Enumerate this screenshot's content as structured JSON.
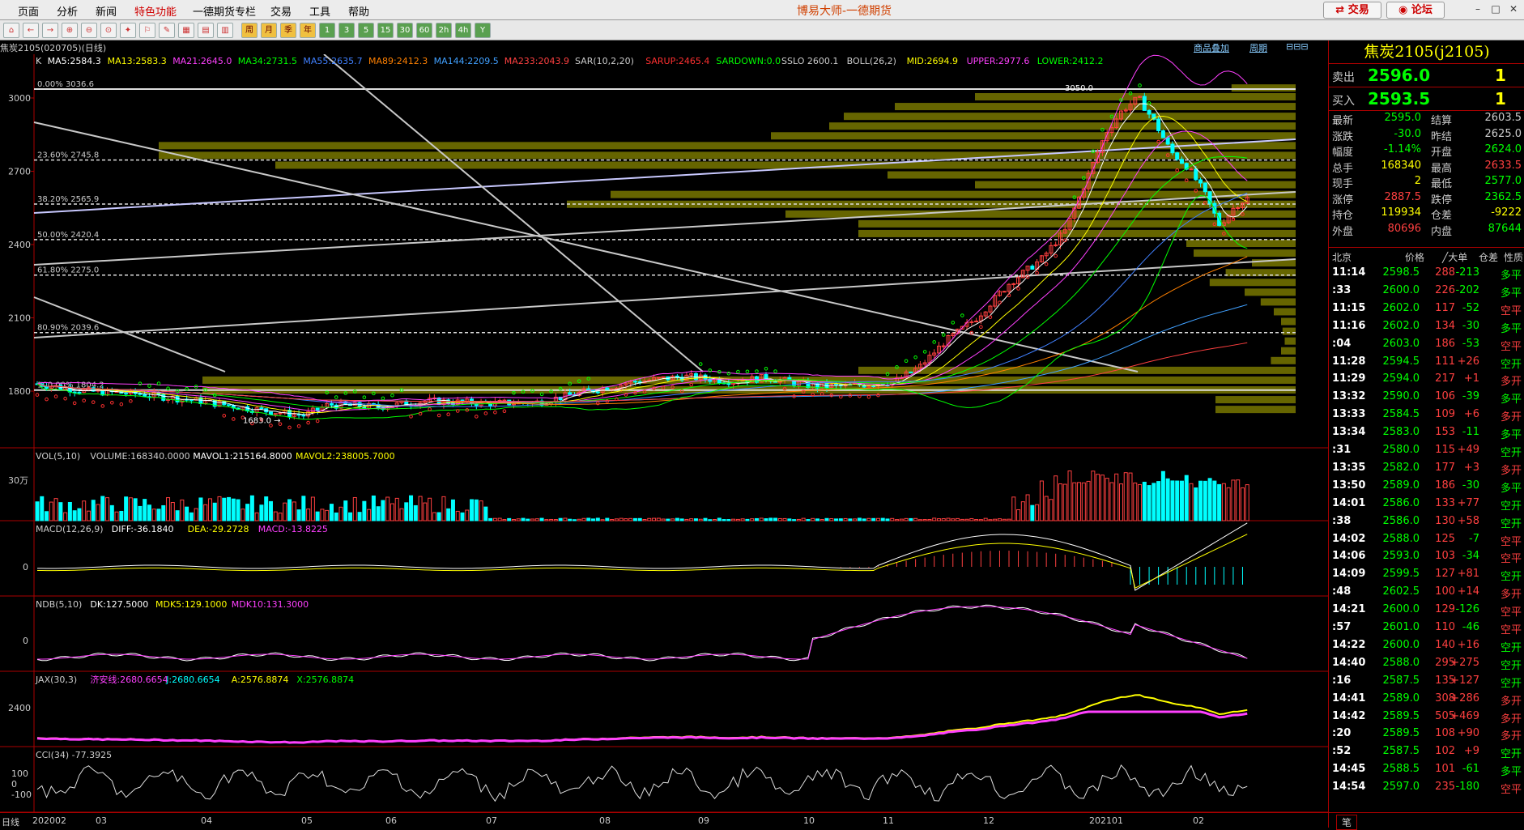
{
  "menu": [
    "页面",
    "分析",
    "新闻",
    "特色功能",
    "一德期货专栏",
    "交易",
    "工具",
    "帮助"
  ],
  "app_title": "博易大师-一德期货",
  "trade_button": "交易",
  "forum_button": "论坛",
  "toolbar_period_buttons": [
    "周",
    "月",
    "季",
    "年",
    "1",
    "3",
    "5",
    "15",
    "30",
    "60",
    "2h",
    "4h",
    "Y"
  ],
  "contract_label": "焦炭2105(020705)(日线)",
  "links": {
    "overlay": "商品叠加",
    "period": "周期"
  },
  "main_indicator": "K  MA5:2584.3  MA13:2583.3  MA21:2645.0  MA34:2731.5  MA55:2635.7  MA89:2412.3  MA144:2209.5  MA233:2043.9  SAR(10,2,20)  SARUP:2465.4  SARDOWN:0.0  SSLO 2600.1  BOLL(26,2)  MID:2694.9  UPPER:2977.6  LOWER:2412.2",
  "main_indicator_parts": [
    {
      "t": "K",
      "c": "#dddddd"
    },
    {
      "t": "MA5:2584.3",
      "c": "#ffffff"
    },
    {
      "t": "MA13:2583.3",
      "c": "#ffff00"
    },
    {
      "t": "MA21:2645.0",
      "c": "#ff40ff"
    },
    {
      "t": "MA34:2731.5",
      "c": "#00ff00"
    },
    {
      "t": "MA55:2635.7",
      "c": "#4080ff"
    },
    {
      "t": "MA89:2412.3",
      "c": "#ff8000"
    },
    {
      "t": "MA144:2209.5",
      "c": "#40a0ff"
    },
    {
      "t": "MA233:2043.9",
      "c": "#ff4040"
    },
    {
      "t": "SAR(10,2,20)",
      "c": "#cccccc"
    },
    {
      "t": "SARUP:2465.4",
      "c": "#ff3030"
    },
    {
      "t": "SARDOWN:0.0",
      "c": "#00ff00"
    },
    {
      "t": "SSLO 2600.1",
      "c": "#cccccc"
    },
    {
      "t": "BOLL(26,2)",
      "c": "#cccccc"
    },
    {
      "t": "MID:2694.9",
      "c": "#ffff00"
    },
    {
      "t": "UPPER:2977.6",
      "c": "#ff40ff"
    },
    {
      "t": "LOWER:2412.2",
      "c": "#00ff00"
    }
  ],
  "y_axis_main": [
    "3000",
    "2700",
    "2400",
    "2100",
    "1800"
  ],
  "fib_labels": [
    "0.00% 3036.6",
    "23.60% 2745.8",
    "38.20% 2565.9",
    "50.00% 2420.4",
    "61.80% 2275.0",
    "80.90% 2039.6",
    "100.00% 1804.2"
  ],
  "price_annotations": {
    "high": "3050.0",
    "low": "1683.0"
  },
  "vol_indicator_parts": [
    {
      "t": "VOL(5,10)",
      "c": "#cccccc"
    },
    {
      "t": "VOLUME:168340.0000",
      "c": "#cccccc"
    },
    {
      "t": "MAVOL1:215164.8000",
      "c": "#ffffff"
    },
    {
      "t": "MAVOL2:238005.7000",
      "c": "#ffff00"
    }
  ],
  "vol_axis": "30万",
  "macd_parts": [
    {
      "t": "MACD(12,26,9)",
      "c": "#cccccc"
    },
    {
      "t": "DIFF:-36.1840",
      "c": "#ffffff"
    },
    {
      "t": "DEA:-29.2728",
      "c": "#ffff00"
    },
    {
      "t": "MACD:-13.8225",
      "c": "#ff40ff"
    }
  ],
  "macd_axis": "0",
  "ndb_parts": [
    {
      "t": "NDB(5,10)",
      "c": "#cccccc"
    },
    {
      "t": "DK:127.5000",
      "c": "#ffffff"
    },
    {
      "t": "MDK5:129.1000",
      "c": "#ffff00"
    },
    {
      "t": "MDK10:131.3000",
      "c": "#ff40ff"
    }
  ],
  "ndb_axis": "0",
  "jax_parts": [
    {
      "t": "JAX(30,3)",
      "c": "#cccccc"
    },
    {
      "t": "济安线:2680.6654",
      "c": "#ff40ff"
    },
    {
      "t": "J:2680.6654",
      "c": "#00ffff"
    },
    {
      "t": "A:2576.8874",
      "c": "#ffff00"
    },
    {
      "t": "X:2576.8874",
      "c": "#00ff00"
    }
  ],
  "jax_axis": "2400",
  "cci_label": "CCI(34) -77.3925",
  "cci_axis": [
    "100",
    "0",
    "-100"
  ],
  "x_axis": [
    "日线",
    "202002",
    "03",
    "04",
    "05",
    "06",
    "07",
    "08",
    "09",
    "10",
    "11",
    "12",
    "202101",
    "02"
  ],
  "right_panel": {
    "title": "焦炭2105(j2105)",
    "sell": {
      "label": "卖出",
      "price": "2596.0",
      "vol": "1"
    },
    "buy": {
      "label": "买入",
      "price": "2593.5",
      "vol": "1"
    },
    "stats": [
      {
        "l": "最新",
        "v": "2595.0",
        "c": "#00ff00",
        "l2": "结算",
        "v2": "2603.5",
        "c2": "#cccccc"
      },
      {
        "l": "涨跌",
        "v": "-30.0",
        "c": "#00ff00",
        "l2": "昨结",
        "v2": "2625.0",
        "c2": "#cccccc"
      },
      {
        "l": "幅度",
        "v": "-1.14%",
        "c": "#00ff00",
        "l2": "开盘",
        "v2": "2624.0",
        "c2": "#00ff00"
      },
      {
        "l": "总手",
        "v": "168340",
        "c": "#ffff00",
        "l2": "最高",
        "v2": "2633.5",
        "c2": "#ff4040"
      },
      {
        "l": "现手",
        "v": "2",
        "c": "#ffff00",
        "l2": "最低",
        "v2": "2577.0",
        "c2": "#00ff00"
      },
      {
        "l": "涨停",
        "v": "2887.5",
        "c": "#ff4040",
        "l2": "跌停",
        "v2": "2362.5",
        "c2": "#00ff00"
      },
      {
        "l": "持仓",
        "v": "119934",
        "c": "#ffff00",
        "l2": "仓差",
        "v2": "-9222",
        "c2": "#ffff00"
      },
      {
        "l": "外盘",
        "v": "80696",
        "c": "#ff4040",
        "l2": "内盘",
        "v2": "87644",
        "c2": "#00ff00"
      }
    ],
    "tick_header": [
      "北京",
      "价格",
      "╱大单",
      "仓差",
      "性质"
    ],
    "ticks": [
      {
        "t": "11:14",
        "p": "2598.5",
        "v": "288",
        "d": "-213",
        "n": "多平"
      },
      {
        "t": ":33",
        "p": "2600.0",
        "v": "226",
        "d": "-202",
        "n": "多平"
      },
      {
        "t": "11:15",
        "p": "2602.0",
        "v": "117",
        "d": "-52",
        "n": "空平"
      },
      {
        "t": "11:16",
        "p": "2602.0",
        "v": "134",
        "d": "-30",
        "n": "多平"
      },
      {
        "t": ":04",
        "p": "2603.0",
        "v": "186",
        "d": "-53",
        "n": "空平"
      },
      {
        "t": "11:28",
        "p": "2594.5",
        "v": "111",
        "d": "+26",
        "n": "空开"
      },
      {
        "t": "11:29",
        "p": "2594.0",
        "v": "217",
        "d": "+1",
        "n": "多开"
      },
      {
        "t": "13:32",
        "p": "2590.0",
        "v": "106",
        "d": "-39",
        "n": "多平"
      },
      {
        "t": "13:33",
        "p": "2584.5",
        "v": "109",
        "d": "+6",
        "n": "多开"
      },
      {
        "t": "13:34",
        "p": "2583.0",
        "v": "153",
        "d": "-11",
        "n": "多平"
      },
      {
        "t": ":31",
        "p": "2580.0",
        "v": "115",
        "d": "+49",
        "n": "空开"
      },
      {
        "t": "13:35",
        "p": "2582.0",
        "v": "177",
        "d": "+3",
        "n": "多开"
      },
      {
        "t": "13:50",
        "p": "2589.0",
        "v": "186",
        "d": "-30",
        "n": "多平"
      },
      {
        "t": "14:01",
        "p": "2586.0",
        "v": "133",
        "d": "+77",
        "n": "空开"
      },
      {
        "t": ":38",
        "p": "2586.0",
        "v": "130",
        "d": "+58",
        "n": "空开"
      },
      {
        "t": "14:02",
        "p": "2588.0",
        "v": "125",
        "d": "-7",
        "n": "空平"
      },
      {
        "t": "14:06",
        "p": "2593.0",
        "v": "103",
        "d": "-34",
        "n": "空平"
      },
      {
        "t": "14:09",
        "p": "2599.5",
        "v": "127",
        "d": "+81",
        "n": "空开"
      },
      {
        "t": ":48",
        "p": "2602.5",
        "v": "100",
        "d": "+14",
        "n": "多开"
      },
      {
        "t": "14:21",
        "p": "2600.0",
        "v": "129",
        "d": "-126",
        "n": "空平"
      },
      {
        "t": ":57",
        "p": "2601.0",
        "v": "110",
        "d": "-46",
        "n": "空平"
      },
      {
        "t": "14:22",
        "p": "2600.0",
        "v": "140",
        "d": "+16",
        "n": "空开"
      },
      {
        "t": "14:40",
        "p": "2588.0",
        "v": "295",
        "d": "+275",
        "n": "空开"
      },
      {
        "t": ":16",
        "p": "2587.5",
        "v": "135",
        "d": "+127",
        "n": "空开"
      },
      {
        "t": "14:41",
        "p": "2589.0",
        "v": "308",
        "d": "+286",
        "n": "多开"
      },
      {
        "t": "14:42",
        "p": "2589.5",
        "v": "505",
        "d": "+469",
        "n": "多开"
      },
      {
        "t": ":20",
        "p": "2589.5",
        "v": "108",
        "d": "+90",
        "n": "多开"
      },
      {
        "t": ":52",
        "p": "2587.5",
        "v": "102",
        "d": "+9",
        "n": "空开"
      },
      {
        "t": "14:45",
        "p": "2588.5",
        "v": "101",
        "d": "-61",
        "n": "多平"
      },
      {
        "t": "14:54",
        "p": "2597.0",
        "v": "235",
        "d": "-180",
        "n": "空平"
      }
    ],
    "bottom_tab": "笔"
  }
}
